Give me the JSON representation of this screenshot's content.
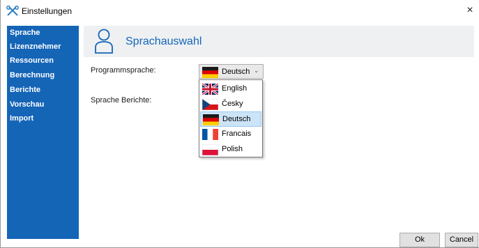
{
  "window": {
    "title": "Einstellungen",
    "close_glyph": "×"
  },
  "sidebar": {
    "items": [
      {
        "label": "Sprache"
      },
      {
        "label": "Lizenznehmer"
      },
      {
        "label": "Ressourcen"
      },
      {
        "label": "Berechnung"
      },
      {
        "label": "Berichte"
      },
      {
        "label": "Vorschau"
      },
      {
        "label": "Import"
      }
    ]
  },
  "header": {
    "title": "Sprachauswahl",
    "icon": "user-icon"
  },
  "form": {
    "program_language_label": "Programmsprache:",
    "report_language_label": "Sprache Berichte:",
    "selected_language": "Deutsch"
  },
  "dropdown": {
    "options": [
      {
        "label": "English",
        "flag": "uk-flag"
      },
      {
        "label": "Česky",
        "flag": "czech-flag"
      },
      {
        "label": "Deutsch",
        "flag": "german-flag",
        "selected": true
      },
      {
        "label": "Francais",
        "flag": "french-flag"
      },
      {
        "label": "Polish",
        "flag": "polish-flag"
      }
    ]
  },
  "buttons": {
    "ok": "Ok",
    "cancel": "Cancel"
  },
  "colors": {
    "sidebar": "#1565b7",
    "accent": "#1565b7",
    "header_bg": "#eef0f2",
    "selection": "#cce4f7"
  }
}
